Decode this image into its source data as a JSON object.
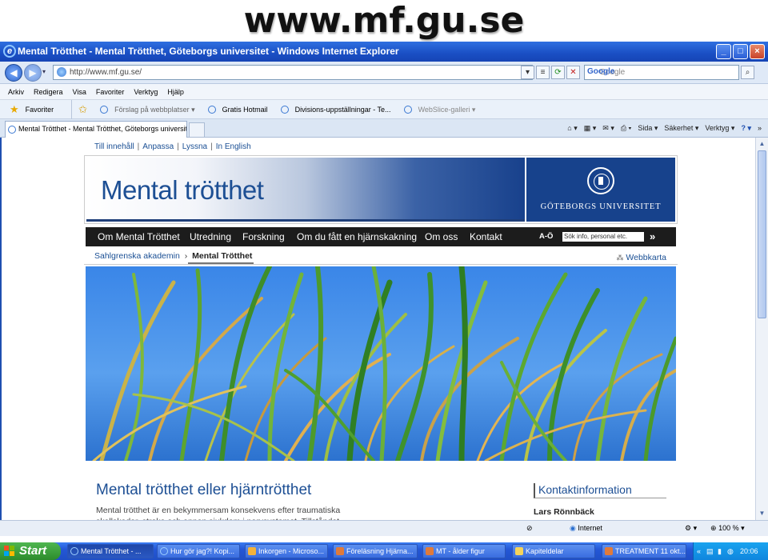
{
  "slide": {
    "title": "www.mf.gu.se"
  },
  "window": {
    "title": "Mental Trötthet - Mental Trötthet, Göteborgs universitet - Windows Internet Explorer",
    "controls": [
      "_",
      "□",
      "×"
    ]
  },
  "address_bar": {
    "url": "http://www.mf.gu.se/",
    "search_placeholder": "Google",
    "search_provider": "Google"
  },
  "menu": [
    "Arkiv",
    "Redigera",
    "Visa",
    "Favoriter",
    "Verktyg",
    "Hjälp"
  ],
  "favorites_bar": {
    "favorites_label": "Favoriter",
    "items": [
      "Förslag på webbplatser ▾",
      "Gratis Hotmail",
      "Divisions-uppställningar - Te...",
      "WebSlice-galleri ▾"
    ]
  },
  "tab": {
    "label": "Mental Trötthet - Mental Trötthet, Göteborgs universitet"
  },
  "command_bar": [
    "Sida ▾",
    "Säkerhet ▾",
    "Verktyg ▾",
    "»"
  ],
  "page": {
    "top_links": [
      "Till innehåll",
      "Anpassa",
      "Lyssna",
      "In English"
    ],
    "site_title": "Mental trötthet",
    "university": "GÖTEBORGS UNIVERSITET",
    "nav": [
      "Om Mental Trötthet",
      "Utredning",
      "Forskning",
      "Om du fått en hjärnskakning",
      "Om oss",
      "Kontakt"
    ],
    "az_label": "A-Ö",
    "search_placeholder": "Sök info, personal etc.",
    "search_go": "»",
    "breadcrumb": {
      "parent": "Sahlgrenska akademin",
      "separator": "›",
      "current": "Mental Trötthet"
    },
    "sitemap_label": "Webbkarta",
    "content_title": "Mental trötthet eller hjärntrötthet",
    "content_text": "Mental trötthet är en bekymmersam konsekvens efter traumatiska skallskador, stroke och annan sjukdom i nervsystemet. Tillståndet",
    "contact_heading": "Kontaktinformation",
    "contact_name": "Lars Rönnbäck"
  },
  "status_bar": {
    "zone": "Internet",
    "zoom": "100 %"
  },
  "taskbar": {
    "start_label": "Start",
    "tasks": [
      "Mental Trötthet - ...",
      "Hur gör jag?! Kopi...",
      "Inkorgen - Microso...",
      "Föreläsning Hjärna...",
      "MT - ålder figur",
      "Kapiteldelar",
      "TREATMENT 11 okt..."
    ],
    "clock": "20:06"
  },
  "colors": {
    "brand_blue": "#1d4f94",
    "university_blue": "#17428c",
    "nav_black": "#1c1c1c",
    "xp_blue": "#2457d6",
    "start_green": "#2c8b2c"
  }
}
